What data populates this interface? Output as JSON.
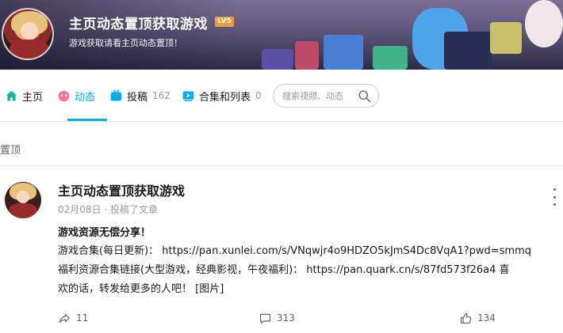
{
  "colors": {
    "accent": "#00aeec",
    "level_badge": "#f19b38",
    "muted": "#9499a0",
    "text": "#18191c"
  },
  "profile": {
    "username": "主页动态置顶获取游戏",
    "level": "LV5",
    "sign": "游戏获取请看主页动态置顶！"
  },
  "nav": {
    "items": [
      {
        "label": "主页",
        "icon": "home-icon",
        "count": ""
      },
      {
        "label": "动态",
        "icon": "dynamic-icon",
        "count": "",
        "active": true
      },
      {
        "label": "投稿",
        "icon": "video-icon",
        "count": "162"
      },
      {
        "label": "合集和列表",
        "icon": "playlist-icon",
        "count": "0"
      }
    ],
    "search_placeholder": "搜索视频、动态"
  },
  "pinned_label": "置顶",
  "post": {
    "author": "主页动态置顶获取游戏",
    "date": "02月08日",
    "action": "· 投稿了文章",
    "title": "游戏资源无偿分享！",
    "lines": [
      "游戏合集(每日更新)： https://pan.xunlei.com/s/VNqwjr4o9HDZO5kJmS4Dc8VqA1?pwd=smmq",
      "福利资源合集链接(大型游戏，经典影视，午夜福利)： https://pan.quark.cn/s/87fd573f26a4 喜",
      "欢的话，转发给更多的人吧！ [图片]"
    ],
    "share_count": "11",
    "comment_count": "313",
    "like_count": "134"
  }
}
